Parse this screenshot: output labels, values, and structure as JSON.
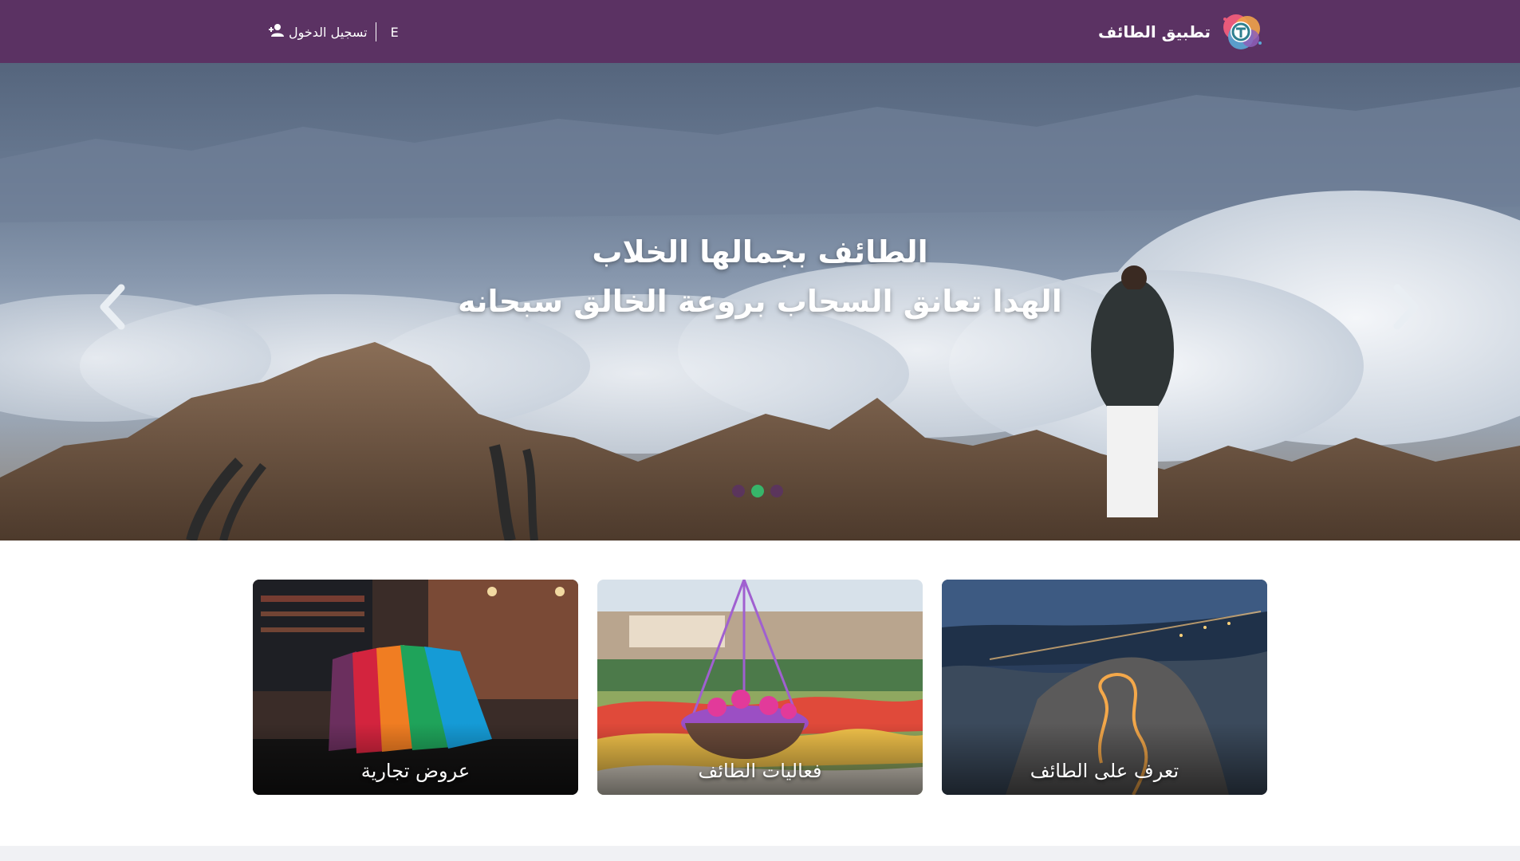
{
  "header": {
    "brand_name": "تطبيق الطائف",
    "login_label": "تسجيل الدخول",
    "language_label": "E",
    "background_color": "#5b3263"
  },
  "hero": {
    "title_line1": "الطائف بجمالها الخلاب",
    "title_line2": "الهدا تعانق السحاب بروعة الخالق سبحانه",
    "prev_icon": "chevron-left-icon",
    "next_icon": "chevron-right-icon",
    "slides_count": 3,
    "active_slide": 2,
    "indicator_color": "#5b3263",
    "active_indicator_color": "#37b56a"
  },
  "cards": [
    {
      "label": "عروض تجارية"
    },
    {
      "label": "فعاليات الطائف"
    },
    {
      "label": "تعرف على الطائف"
    }
  ]
}
